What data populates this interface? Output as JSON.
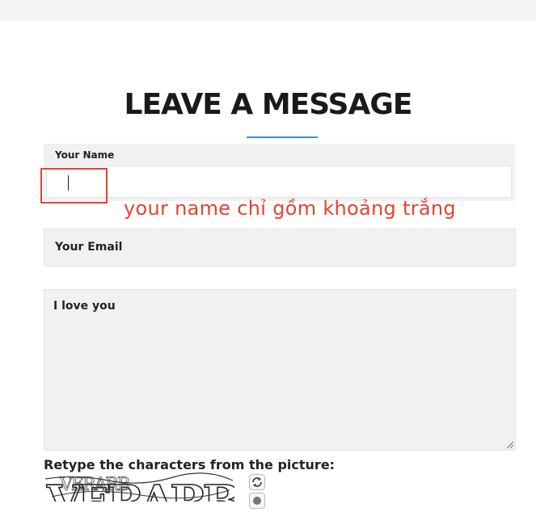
{
  "page": {
    "title": "LEAVE A MESSAGE"
  },
  "form": {
    "name_label": "Your Name",
    "name_value": "",
    "email_placeholder": "Your Email",
    "message_value": "I love you",
    "captcha_label": "Retype the characters from the picture:",
    "captcha_text": "VERARB"
  },
  "annotation": {
    "text": "your name chỉ gồm khoảng trắng",
    "color": "#e3442f"
  },
  "colors": {
    "accent": "#3b8fd6",
    "field_bg": "#f1f1f1"
  },
  "icons": {
    "captcha_refresh": "refresh-icon",
    "captcha_audio": "audio-icon"
  }
}
